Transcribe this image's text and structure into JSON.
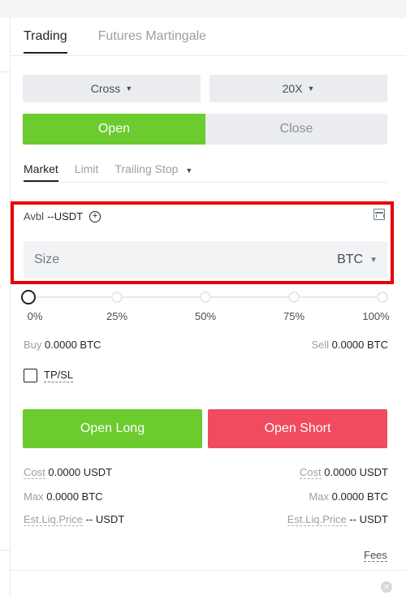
{
  "tabs": [
    {
      "label": "Trading",
      "active": true
    },
    {
      "label": "Futures Martingale",
      "active": false
    }
  ],
  "margin_mode": {
    "value": "Cross",
    "icon": "caret-down-icon"
  },
  "leverage": {
    "value": "20X",
    "icon": "caret-down-icon"
  },
  "open_close": {
    "open_label": "Open",
    "close_label": "Close",
    "selected": "Open"
  },
  "order_types": [
    {
      "label": "Market",
      "active": true
    },
    {
      "label": "Limit",
      "active": false
    },
    {
      "label": "Trailing Stop",
      "active": false,
      "dropdown": true
    }
  ],
  "available": {
    "label": "Avbl",
    "value": "--USDT"
  },
  "size": {
    "placeholder": "Size",
    "unit": "BTC",
    "value": ""
  },
  "slider": {
    "labels": [
      "0%",
      "25%",
      "50%",
      "75%",
      "100%"
    ],
    "value": 0
  },
  "buy_sell": {
    "buy_label": "Buy",
    "buy_value": "0.0000 BTC",
    "sell_label": "Sell",
    "sell_value": "0.0000 BTC"
  },
  "tpsl": {
    "label": "TP/SL",
    "checked": false
  },
  "actions": {
    "long_label": "Open Long",
    "short_label": "Open Short"
  },
  "details": {
    "cost_label": "Cost",
    "cost_long": "0.0000 USDT",
    "cost_short": "0.0000 USDT",
    "max_label": "Max",
    "max_long": "0.0000 BTC",
    "max_short": "0.0000 BTC",
    "liq_label": "Est.Liq.Price",
    "liq_long": "-- USDT",
    "liq_short": "-- USDT"
  },
  "fees_label": "Fees",
  "colors": {
    "accent_green": "#6ccb2f",
    "accent_red": "#f04b5e",
    "highlight_border": "#e90000"
  }
}
